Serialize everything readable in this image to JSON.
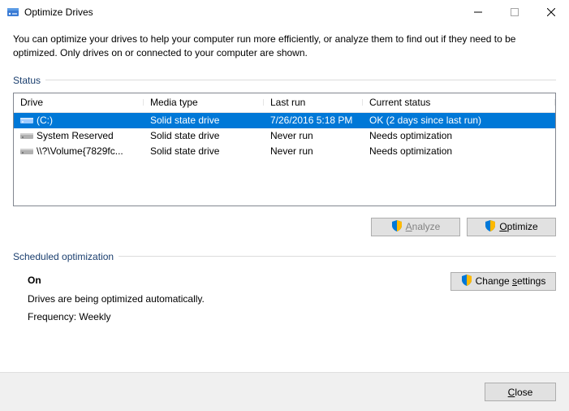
{
  "window": {
    "title": "Optimize Drives"
  },
  "intro": "You can optimize your drives to help your computer run more efficiently, or analyze them to find out if they need to be optimized. Only drives on or connected to your computer are shown.",
  "status_label": "Status",
  "columns": {
    "drive": "Drive",
    "media": "Media type",
    "last": "Last run",
    "status": "Current status"
  },
  "rows": [
    {
      "drive": "(C:)",
      "media": "Solid state drive",
      "last": "7/26/2016 5:18 PM",
      "status": "OK (2 days since last run)",
      "selected": true,
      "icon": "ssd"
    },
    {
      "drive": "System Reserved",
      "media": "Solid state drive",
      "last": "Never run",
      "status": "Needs optimization",
      "selected": false,
      "icon": "hdd"
    },
    {
      "drive": "\\\\?\\Volume{7829fc...",
      "media": "Solid state drive",
      "last": "Never run",
      "status": "Needs optimization",
      "selected": false,
      "icon": "hdd"
    }
  ],
  "buttons": {
    "analyze": "Analyze",
    "optimize": "Optimize",
    "change_settings": "Change settings",
    "close": "Close"
  },
  "sched_label": "Scheduled optimization",
  "sched": {
    "state": "On",
    "line1": "Drives are being optimized automatically.",
    "line2": "Frequency: Weekly"
  }
}
